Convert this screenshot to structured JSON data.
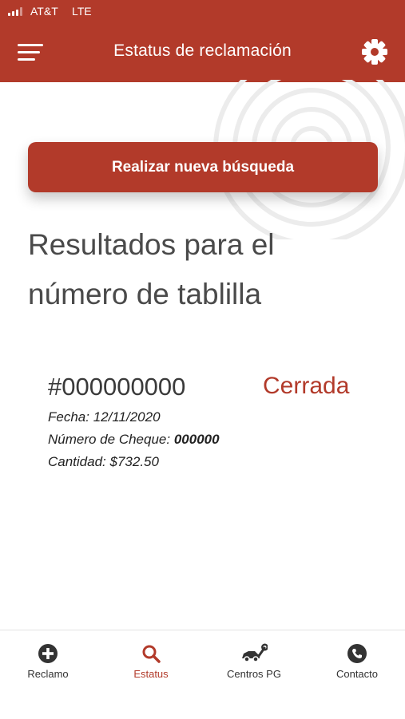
{
  "status_bar": {
    "carrier": "AT&T",
    "network": "LTE"
  },
  "header": {
    "title": "Estatus de reclamación",
    "menu_icon": "hamburger-menu-icon",
    "settings_icon": "gear-icon"
  },
  "colors": {
    "brand": "#b23a2a",
    "text": "#4a4a4a",
    "background": "#ffffff"
  },
  "search": {
    "button_label": "Realizar nueva búsqueda"
  },
  "results": {
    "heading": "Resultados para el número de tablilla",
    "claim": {
      "plate": "#000000000",
      "status": "Cerrada",
      "date_label": "Fecha:",
      "date_value": "12/11/2020",
      "check_label": "Número de Cheque:",
      "check_value": "000000",
      "amount_label": "Cantidad:",
      "amount_value": "$732.50"
    }
  },
  "tabs": [
    {
      "label": "Reclamo",
      "icon": "plus-circle-icon",
      "active": false
    },
    {
      "label": "Estatus",
      "icon": "search-icon",
      "active": true
    },
    {
      "label": "Centros PG",
      "icon": "car-wrench-icon",
      "active": false
    },
    {
      "label": "Contacto",
      "icon": "phone-icon",
      "active": false
    }
  ]
}
